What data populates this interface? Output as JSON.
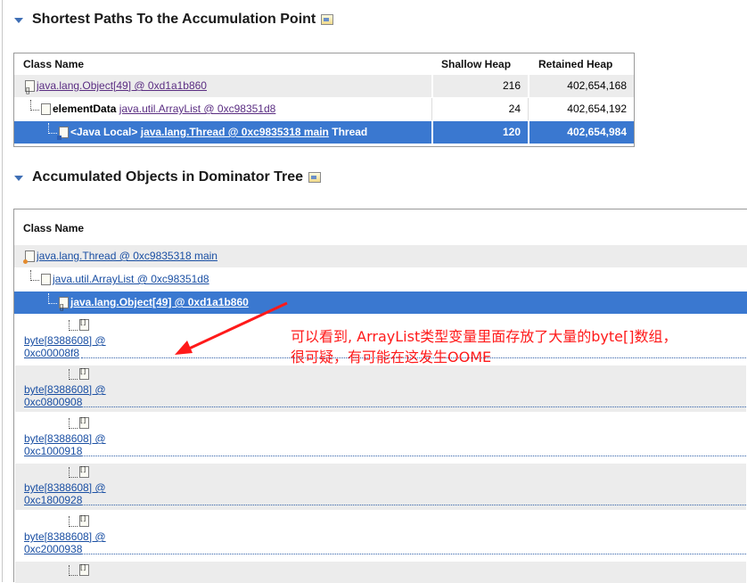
{
  "section1": {
    "title": "Shortest Paths To the Accumulation Point",
    "headers": {
      "class_name": "Class Name",
      "shallow": "Shallow Heap",
      "retained": "Retained Heap"
    },
    "rows": [
      {
        "type_link": "java.lang.Object[49] @ 0xd1a1b860",
        "shallow": "216",
        "retained": "402,654,168"
      },
      {
        "field": "elementData",
        "type_link": "java.util.ArrayList @ 0xc98351d8",
        "shallow": "24",
        "retained": "402,654,192"
      },
      {
        "field": "<Java Local>",
        "type_link": "java.lang.Thread @ 0xc9835318 main",
        "suffix": "Thread",
        "shallow": "120",
        "retained": "402,654,984"
      }
    ]
  },
  "section2": {
    "title": "Accumulated Objects in Dominator Tree",
    "headers": {
      "class_name": "Class Name"
    },
    "tree": [
      "java.lang.Thread @ 0xc9835318 main",
      "java.util.ArrayList @ 0xc98351d8",
      "java.lang.Object[49] @ 0xd1a1b860"
    ],
    "items": [
      {
        "line1": "byte[8388608] @",
        "line2": "0xc00008f8"
      },
      {
        "line1": "byte[8388608] @",
        "line2": "0xc0800908"
      },
      {
        "line1": "byte[8388608] @",
        "line2": "0xc1000918"
      },
      {
        "line1": "byte[8388608] @",
        "line2": "0xc1800928"
      },
      {
        "line1": "byte[8388608] @",
        "line2": "0xc2000938"
      }
    ]
  },
  "annotation": {
    "line1": "可以看到, ArrayList类型变量里面存放了大量的byte[]数组，",
    "line2": "很可疑，有可能在这发生OOME",
    "color": "#ff1a1a"
  },
  "colors": {
    "selection": "#3a78d0",
    "link_purple": "#5a2d82",
    "link_blue": "#1a4fa3",
    "row_alt": "#ececec"
  }
}
